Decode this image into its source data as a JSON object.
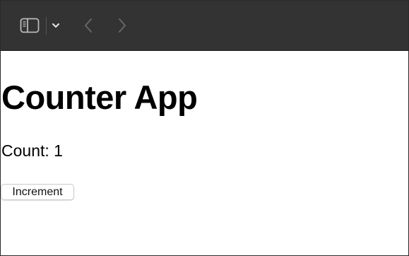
{
  "toolbar": {
    "background": "#333333",
    "icons": {
      "sidebar": "sidebar-toggle-icon",
      "dropdown": "chevron-down-icon",
      "back": "chevron-left-icon",
      "forward": "chevron-right-icon"
    }
  },
  "main": {
    "title": "Counter App",
    "count_text": "Count: 1",
    "increment_label": "Increment"
  }
}
